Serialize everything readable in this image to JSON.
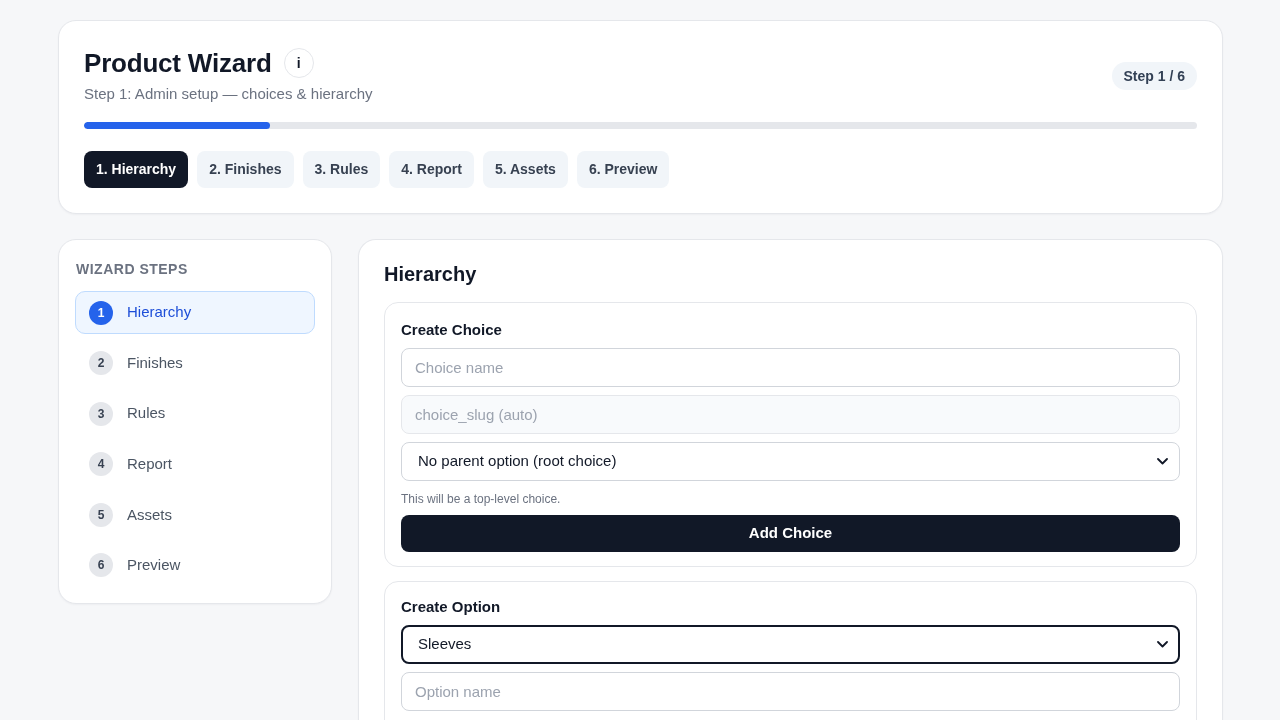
{
  "header": {
    "title": "Product Wizard",
    "info_button": "i",
    "subtitle": "Step 1: Admin setup — choices & hierarchy",
    "step_badge": "Step 1 / 6",
    "progress": {
      "level": 0.1667
    }
  },
  "tabs": [
    {
      "label": "1. Hierarchy",
      "selected": true
    },
    {
      "label": "2. Finishes",
      "selected": false
    },
    {
      "label": "3. Rules",
      "selected": false
    },
    {
      "label": "4. Report",
      "selected": false
    },
    {
      "label": "5. Assets",
      "selected": false
    },
    {
      "label": "6. Preview",
      "selected": false
    }
  ],
  "sidebar": {
    "title": "WIZARD STEPS",
    "items": [
      {
        "number": "1",
        "label": "Hierarchy",
        "selected": true
      },
      {
        "number": "2",
        "label": "Finishes",
        "selected": false
      },
      {
        "number": "3",
        "label": "Rules",
        "selected": false
      },
      {
        "number": "4",
        "label": "Report",
        "selected": false
      },
      {
        "number": "5",
        "label": "Assets",
        "selected": false
      },
      {
        "number": "6",
        "label": "Preview",
        "selected": false
      }
    ]
  },
  "main": {
    "title": "Hierarchy",
    "sections": [
      {
        "title": "Create Choice",
        "fields": [
          {
            "kind": "input",
            "placeholder": "Choice name",
            "disabled": false
          },
          {
            "kind": "input",
            "placeholder": "choice_slug (auto)",
            "disabled": true
          },
          {
            "kind": "select",
            "value": "No parent option (root choice)",
            "focused": false
          }
        ],
        "help": "This will be a top-level choice.",
        "button": "Add Choice"
      },
      {
        "title": "Create Option",
        "fields": [
          {
            "kind": "select",
            "value": "Sleeves",
            "focused": true
          },
          {
            "kind": "input",
            "placeholder": "Option name",
            "disabled": false
          }
        ]
      }
    ]
  }
}
